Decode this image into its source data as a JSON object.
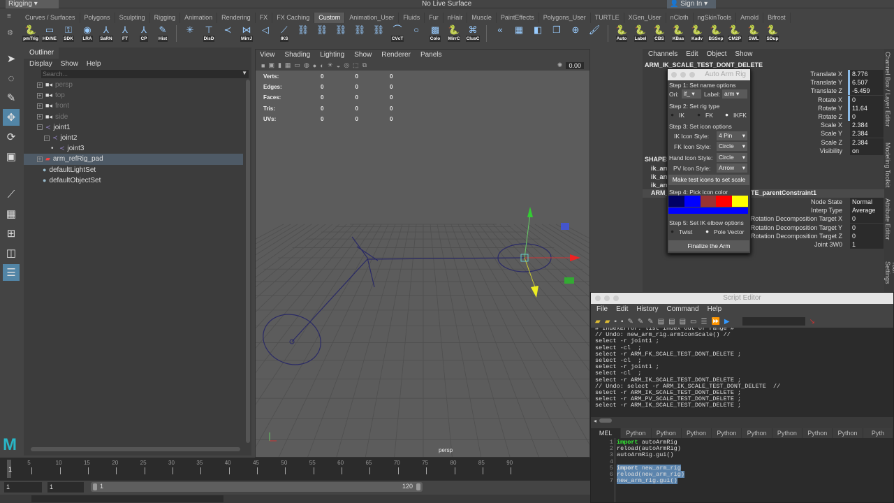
{
  "status_line": {
    "menu_set": "Rigging",
    "live_surface": "No Live Surface",
    "sign_in": "Sign In"
  },
  "shelf_tabs": [
    "Curves / Surfaces",
    "Polygons",
    "Sculpting",
    "Rigging",
    "Animation",
    "Rendering",
    "FX",
    "FX Caching",
    "Custom",
    "Animation_User",
    "Fluids",
    "Fur",
    "nHair",
    "Muscle",
    "PaintEffects",
    "Polygons_User",
    "TURTLE",
    "XGen_User",
    "nCloth",
    "ngSkinTools",
    "Arnold",
    "Bifrost"
  ],
  "active_shelf_tab": "Custom",
  "shelf_buttons": [
    {
      "icon": "python-icon",
      "label": "pmTrig"
    },
    {
      "icon": "window-icon",
      "label": "HD/NE"
    },
    {
      "icon": "key-icon",
      "label": "SDK"
    },
    {
      "icon": "eye-icon",
      "label": "LRA"
    },
    {
      "icon": "axis-icon",
      "label": "SaRN"
    },
    {
      "icon": "axis-icon",
      "label": "FT"
    },
    {
      "icon": "axis-icon",
      "label": "CP"
    },
    {
      "icon": "pencil-icon",
      "label": "Hist"
    },
    {
      "icon": "asterisk-icon",
      "label": ""
    },
    {
      "icon": "distance-icon",
      "label": "DisD"
    },
    {
      "icon": "joint-icon",
      "label": ""
    },
    {
      "icon": "mirror-joint-icon",
      "label": "MirrJ"
    },
    {
      "icon": "joint-orient-icon",
      "label": ""
    },
    {
      "icon": "ik-spline-icon",
      "label": "IKS"
    },
    {
      "icon": "constraint-icon",
      "label": ""
    },
    {
      "icon": "constraint-icon",
      "label": ""
    },
    {
      "icon": "constraint-icon",
      "label": ""
    },
    {
      "icon": "constraint-icon",
      "label": ""
    },
    {
      "icon": "constraint-icon",
      "label": ""
    },
    {
      "icon": "cv-curve-icon",
      "label": "CVcT"
    },
    {
      "icon": "circle-icon",
      "label": ""
    },
    {
      "icon": "color-icon",
      "label": "Colo"
    },
    {
      "icon": "python-icon",
      "label": "MirrC"
    },
    {
      "icon": "cluster-icon",
      "label": "ClusC"
    },
    {
      "icon": "bend-icon",
      "label": ""
    },
    {
      "icon": "paint-weights-icon",
      "label": ""
    },
    {
      "icon": "mirror-weights-icon",
      "label": ""
    },
    {
      "icon": "copy-weights-icon",
      "label": ""
    },
    {
      "icon": "add-influence-icon",
      "label": ""
    },
    {
      "icon": "brush-icon",
      "label": ""
    },
    {
      "icon": "python-icon",
      "label": "Auto"
    },
    {
      "icon": "python-icon",
      "label": "Label"
    },
    {
      "icon": "python-icon",
      "label": "CBS"
    },
    {
      "icon": "python-icon",
      "label": "KBas"
    },
    {
      "icon": "python-icon",
      "label": "Kadv"
    },
    {
      "icon": "python-icon",
      "label": "BSSep"
    },
    {
      "icon": "python-icon",
      "label": "CM2P"
    },
    {
      "icon": "python-icon",
      "label": "SWL"
    },
    {
      "icon": "python-icon",
      "label": "SDup"
    }
  ],
  "outliner": {
    "title": "Outliner",
    "menu": [
      "Display",
      "Show",
      "Help"
    ],
    "search_placeholder": "Search...",
    "items": [
      {
        "label": "persp",
        "type": "camera",
        "depth": 0,
        "dim": true
      },
      {
        "label": "top",
        "type": "camera",
        "depth": 0,
        "dim": true
      },
      {
        "label": "front",
        "type": "camera",
        "depth": 0,
        "dim": true
      },
      {
        "label": "side",
        "type": "camera",
        "depth": 0,
        "dim": true
      },
      {
        "label": "joint1",
        "type": "joint",
        "depth": 0
      },
      {
        "label": "joint2",
        "type": "joint",
        "depth": 1
      },
      {
        "label": "joint3",
        "type": "joint",
        "depth": 2
      },
      {
        "label": "arm_refRig_pad",
        "type": "mesh",
        "depth": 0,
        "selected": true
      },
      {
        "label": "defaultLightSet",
        "type": "set",
        "depth": 0
      },
      {
        "label": "defaultObjectSet",
        "type": "set",
        "depth": 0
      }
    ]
  },
  "viewport": {
    "menu": [
      "View",
      "Shading",
      "Lighting",
      "Show",
      "Renderer",
      "Panels"
    ],
    "exposure": "0.00",
    "hud": [
      {
        "label": "Verts:",
        "v": [
          "0",
          "0",
          "0"
        ]
      },
      {
        "label": "Edges:",
        "v": [
          "0",
          "0",
          "0"
        ]
      },
      {
        "label": "Faces:",
        "v": [
          "0",
          "0",
          "0"
        ]
      },
      {
        "label": "Tris:",
        "v": [
          "0",
          "0",
          "0"
        ]
      },
      {
        "label": "UVs:",
        "v": [
          "0",
          "0",
          "0"
        ]
      }
    ],
    "camera": "persp"
  },
  "channel_box": {
    "menu": [
      "Channels",
      "Edit",
      "Object",
      "Show"
    ],
    "object": "ARM_IK_SCALE_TEST_DONT_DELETE",
    "attrs": [
      {
        "name": "Translate X",
        "value": "8.776"
      },
      {
        "name": "Translate Y",
        "value": "6.507"
      },
      {
        "name": "Translate Z",
        "value": "-5.459"
      },
      {
        "name": "Rotate X",
        "value": "0"
      },
      {
        "name": "Rotate Y",
        "value": "11.64"
      },
      {
        "name": "Rotate Z",
        "value": "0"
      },
      {
        "name": "Scale X",
        "value": "2.384"
      },
      {
        "name": "Scale Y",
        "value": "2.384"
      },
      {
        "name": "Scale Z",
        "value": "2.384"
      },
      {
        "name": "Visibility",
        "value": "on"
      }
    ],
    "shapes_header": "SHAPES",
    "shapes": [
      "ik_arr",
      "ik_arr",
      "ik_arr"
    ],
    "constraint_prefix": "ARM_",
    "constraint_suffix": "TE_parentConstraint1",
    "constraint_attrs": [
      {
        "name": "Node State",
        "value": "Normal"
      },
      {
        "name": "Interp Type",
        "value": "Average"
      },
      {
        "name": "Rotation Decomposition Target X",
        "value": "0"
      },
      {
        "name": "Rotation Decomposition Target Y",
        "value": "0"
      },
      {
        "name": "Rotation Decomposition Target Z",
        "value": "0"
      },
      {
        "name": "Joint 3W0",
        "value": "1"
      }
    ],
    "side_tabs": [
      "Channel Box / Layer Editor",
      "Modeling Toolkit",
      "Attribute Editor",
      "Tool Settings"
    ]
  },
  "auto_arm_rig": {
    "title": "Auto Arm Rig",
    "step1": "Step 1: Set name options",
    "ori_label": "Ori:",
    "ori_value": "lf_",
    "label_label": "Label:",
    "label_value": "arm",
    "step2": "Step 2: Set rig type",
    "rig_types": [
      "IK",
      "FK",
      "IKFK"
    ],
    "rig_type_selected": "IKFK",
    "step3": "Step 3: Set icon options",
    "icon_options": [
      {
        "label": "IK Icon Style:",
        "value": "4 Pin"
      },
      {
        "label": "FK Icon Style:",
        "value": "Circle"
      },
      {
        "label": "Hand Icon Style:",
        "value": "Circle"
      },
      {
        "label": "PV Icon Style:",
        "value": "Arrow"
      }
    ],
    "test_button": "Make test icons to set scale",
    "step4": "Step 4: Pick icon color",
    "swatches": [
      "#000066",
      "#0000ff",
      "#993333",
      "#ff0000",
      "#ffff00"
    ],
    "selected_color": "#0000ff",
    "step5": "Step 5: Set IK elbow options",
    "elbow_options": [
      "Twist",
      "Pole Vector"
    ],
    "elbow_selected": "Pole Vector",
    "finalize": "Finalize the Arm"
  },
  "script_editor": {
    "title": "Script Editor",
    "menu": [
      "File",
      "Edit",
      "History",
      "Command",
      "Help"
    ],
    "history": [
      "# IndexError: list index out of range #",
      "// Undo: new_arm_rig.armIconScale() //",
      "select -r joint1 ;",
      "select -cl  ;",
      "select -r ARM_FK_SCALE_TEST_DONT_DELETE ;",
      "select -cl  ;",
      "select -r joint1 ;",
      "select -cl  ;",
      "select -r ARM_IK_SCALE_TEST_DONT_DELETE ;",
      "// Undo: select -r ARM_IK_SCALE_TEST_DONT_DELETE  //",
      "select -r ARM_IK_SCALE_TEST_DONT_DELETE ;",
      "select -r ARM_PV_SCALE_TEST_DONT_DELETE ;",
      "select -r ARM_IK_SCALE_TEST_DONT_DELETE ;"
    ],
    "tabs": [
      "MEL",
      "Python",
      "Python",
      "Python",
      "Python",
      "Python",
      "Python",
      "Python",
      "Python",
      "Pyth"
    ],
    "code": [
      {
        "n": "1",
        "kw": "import",
        "rest": " autoArmRig"
      },
      {
        "n": "2",
        "kw": "",
        "rest": "reload(autoArmRig)"
      },
      {
        "n": "3",
        "kw": "",
        "rest": "autoArmRig.gui()"
      },
      {
        "n": "4",
        "kw": "",
        "rest": ""
      },
      {
        "n": "5",
        "kw": "import",
        "rest": " new_arm_rig",
        "sel": true
      },
      {
        "n": "6",
        "kw": "",
        "rest": "reload(new_arm_rig)",
        "sel": true
      },
      {
        "n": "7",
        "kw": "",
        "rest": "new_arm_rig.gui()",
        "sel": true
      }
    ]
  },
  "timeline": {
    "ticks": [
      "5",
      "10",
      "15",
      "20",
      "25",
      "30",
      "35",
      "40",
      "45",
      "50",
      "55",
      "60",
      "65",
      "70",
      "75",
      "80",
      "85",
      "90"
    ],
    "current": "1"
  },
  "range": {
    "start": "1",
    "playback_start": "1",
    "range_start": "1",
    "range_end": "120"
  }
}
